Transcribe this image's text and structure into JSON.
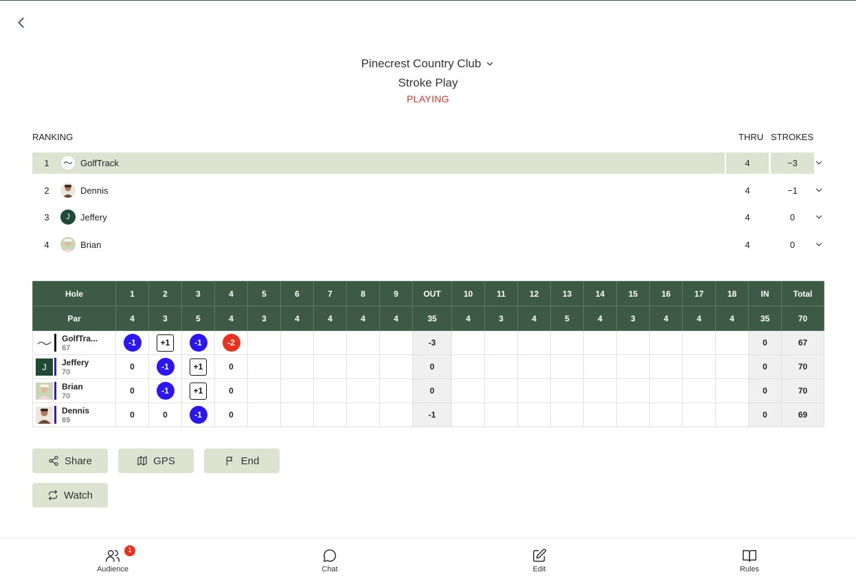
{
  "header": {
    "course": "Pinecrest Country Club",
    "mode": "Stroke Play",
    "status": "PLAYING"
  },
  "ranking": {
    "title": "RANKING",
    "thru_label": "THRU",
    "strokes_label": "STROKES",
    "rows": [
      {
        "pos": "1",
        "name": "GolfTrack",
        "thru": "4",
        "strokes": "−3"
      },
      {
        "pos": "2",
        "name": "Dennis",
        "thru": "4",
        "strokes": "−1"
      },
      {
        "pos": "3",
        "name": "Jeffery",
        "thru": "4",
        "strokes": "0"
      },
      {
        "pos": "4",
        "name": "Brian",
        "thru": "4",
        "strokes": "0"
      }
    ],
    "jeffery_initial": "J"
  },
  "scorecard": {
    "hole_label": "Hole",
    "par_label": "Par",
    "out_label": "OUT",
    "in_label": "IN",
    "total_label": "Total",
    "holes": [
      "1",
      "2",
      "3",
      "4",
      "5",
      "6",
      "7",
      "8",
      "9",
      "10",
      "11",
      "12",
      "13",
      "14",
      "15",
      "16",
      "17",
      "18"
    ],
    "pars": [
      "4",
      "3",
      "5",
      "4",
      "3",
      "4",
      "4",
      "4",
      "4",
      "4",
      "3",
      "4",
      "5",
      "4",
      "3",
      "4",
      "4",
      "4"
    ],
    "par_out": "35",
    "par_in": "35",
    "par_total": "70",
    "players": [
      {
        "name": "GolfTra...",
        "total_label": "67",
        "bar_color": "#111111",
        "scores": [
          "-1",
          "+1",
          "-1",
          "-2"
        ],
        "out": "-3",
        "in": "0",
        "total": "67"
      },
      {
        "name": "Jeffery",
        "total_label": "70",
        "bar_color": "#2a17f2",
        "scores": [
          "0",
          "-1",
          "+1",
          "0"
        ],
        "out": "0",
        "in": "0",
        "total": "70"
      },
      {
        "name": "Brian",
        "total_label": "70",
        "bar_color": "#2a17f2",
        "scores": [
          "0",
          "-1",
          "+1",
          "0"
        ],
        "out": "0",
        "in": "0",
        "total": "70"
      },
      {
        "name": "Dennis",
        "total_label": "69",
        "bar_color": "#2a17f2",
        "scores": [
          "0",
          "0",
          "-1",
          "0"
        ],
        "out": "-1",
        "in": "0",
        "total": "69"
      }
    ]
  },
  "actions": {
    "share": "Share",
    "gps": "GPS",
    "end": "End",
    "watch": "Watch"
  },
  "tabbar": {
    "audience": "Audience",
    "audience_badge": "1",
    "chat": "Chat",
    "edit": "Edit",
    "rules": "Rules"
  },
  "colors": {
    "primary_green": "#3d5a45",
    "highlight": "#dee2d0",
    "birdie": "#2a17f2",
    "eagle": "#e8321e",
    "status_red": "#e0302a"
  },
  "icons": [
    "back-chevron-icon",
    "dropdown-chevron-icon",
    "share-icon",
    "map-icon",
    "flag-icon",
    "repeat-icon",
    "users-icon",
    "chat-bubble-icon",
    "edit-icon",
    "book-icon"
  ]
}
